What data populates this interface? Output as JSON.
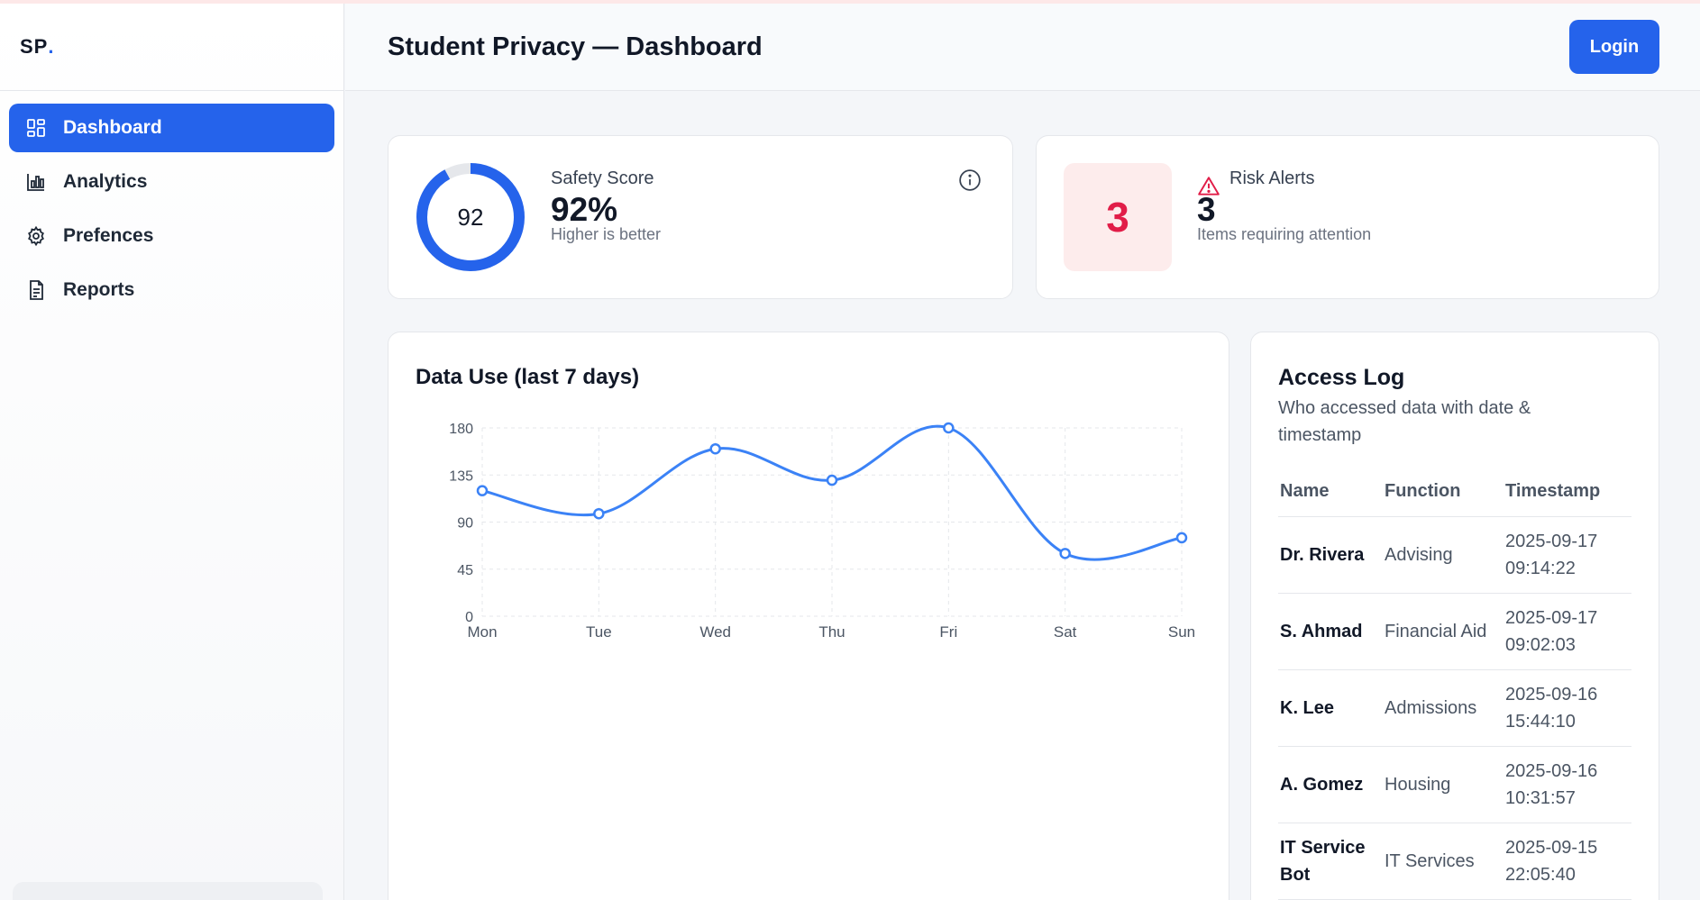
{
  "brand": {
    "text": "SP",
    "dot": "."
  },
  "sidebar": {
    "items": [
      {
        "label": "Dashboard",
        "icon": "dashboard-grid-icon",
        "active": true
      },
      {
        "label": "Analytics",
        "icon": "bar-chart-icon",
        "active": false
      },
      {
        "label": "Prefences",
        "icon": "gear-icon",
        "active": false
      },
      {
        "label": "Reports",
        "icon": "document-icon",
        "active": false
      }
    ]
  },
  "header": {
    "title": "Student Privacy — Dashboard",
    "login_label": "Login"
  },
  "safety": {
    "label": "Safety Score",
    "ring_value": "92",
    "percent": "92%",
    "sub": "Higher is better",
    "score_fraction": 0.92
  },
  "risk": {
    "box_value": "3",
    "label": "Risk Alerts",
    "count": "3",
    "sub": "Items requiring attention"
  },
  "chart_data": {
    "type": "line",
    "title": "Data Use (last 7 days)",
    "categories": [
      "Mon",
      "Tue",
      "Wed",
      "Thu",
      "Fri",
      "Sat",
      "Sun"
    ],
    "series": [
      {
        "values": [
          120,
          98,
          160,
          130,
          180,
          60,
          75
        ]
      }
    ],
    "ylim": [
      0,
      180
    ],
    "yticks": [
      0,
      45,
      90,
      135,
      180
    ],
    "grid": true,
    "color": "#3b82f6"
  },
  "access_log": {
    "title": "Access Log",
    "subtitle": "Who accessed data with date & timestamp",
    "columns": [
      "Name",
      "Function",
      "Timestamp"
    ],
    "rows": [
      {
        "name": "Dr. Rivera",
        "function": "Advising",
        "timestamp": "2025-09-17 09:14:22"
      },
      {
        "name": "S. Ahmad",
        "function": "Financial Aid",
        "timestamp": "2025-09-17 09:02:03"
      },
      {
        "name": "K. Lee",
        "function": "Admissions",
        "timestamp": "2025-09-16 15:44:10"
      },
      {
        "name": "A. Gomez",
        "function": "Housing",
        "timestamp": "2025-09-16 10:31:57"
      },
      {
        "name": "IT Service Bot",
        "function": "IT Services",
        "timestamp": "2025-09-15 22:05:40"
      }
    ]
  },
  "colors": {
    "accent": "#2563eb",
    "danger": "#e11d48",
    "danger_bg": "#fdecec"
  }
}
